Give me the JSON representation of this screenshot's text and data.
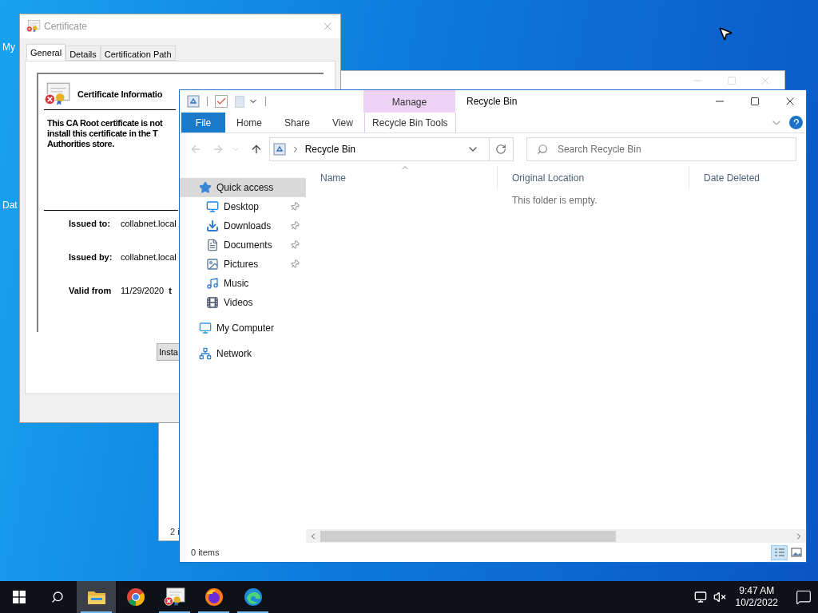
{
  "desktop_icons": [
    {
      "label": "My"
    },
    {
      "label": "Dat"
    }
  ],
  "certificate_window": {
    "title": "Certificate",
    "tabs": [
      {
        "label": "General",
        "selected": true
      },
      {
        "label": "Details",
        "selected": false
      },
      {
        "label": "Certification Path",
        "selected": false
      }
    ],
    "heading": "Certificate Informatio",
    "message_lines": [
      "This CA Root certificate is not",
      "install this certificate in the T",
      "Authorities store."
    ],
    "fields": [
      {
        "label": "Issued to:",
        "value": "collabnet.local"
      },
      {
        "label": "Issued by:",
        "value": "collabnet.local"
      },
      {
        "label": "Valid from",
        "value": "11/29/2020",
        "tail": "t"
      }
    ],
    "button": "Insta"
  },
  "background_window": {
    "status": "2 i"
  },
  "explorer": {
    "title": "Recycle Bin",
    "context_tab": "Manage",
    "ribbon_tabs": [
      {
        "label": "File",
        "kind": "file"
      },
      {
        "label": "Home",
        "kind": "plain"
      },
      {
        "label": "Share",
        "kind": "plain"
      },
      {
        "label": "View",
        "kind": "plain"
      },
      {
        "label": "Recycle Bin Tools",
        "kind": "contextual"
      }
    ],
    "address": "Recycle Bin",
    "search": {
      "placeholder": "Search Recycle Bin"
    },
    "nav": [
      {
        "label": "Quick access",
        "kind": "quick-access",
        "selected": true,
        "pinned": false,
        "children": [
          {
            "label": "Desktop",
            "kind": "desktop",
            "selected": false,
            "pinned": true
          },
          {
            "label": "Downloads",
            "kind": "downloads",
            "selected": false,
            "pinned": true
          },
          {
            "label": "Documents",
            "kind": "documents",
            "selected": false,
            "pinned": true
          },
          {
            "label": "Pictures",
            "kind": "pictures",
            "selected": false,
            "pinned": true
          },
          {
            "label": "Music",
            "kind": "music",
            "selected": false,
            "pinned": false
          },
          {
            "label": "Videos",
            "kind": "videos",
            "selected": false,
            "pinned": false
          }
        ]
      },
      {
        "label": "My Computer",
        "kind": "computer",
        "selected": false,
        "pinned": false
      },
      {
        "label": "Network",
        "kind": "network",
        "selected": false,
        "pinned": false
      }
    ],
    "columns": [
      {
        "label": "Name",
        "sorted": true
      },
      {
        "label": "Original Location",
        "sorted": false
      },
      {
        "label": "Date Deleted",
        "sorted": false
      }
    ],
    "empty_message": "This folder is empty.",
    "status": "0 items",
    "views": [
      {
        "kind": "details",
        "selected": true
      },
      {
        "kind": "large-icons",
        "selected": false
      }
    ]
  },
  "taskbar": {
    "apps": [
      {
        "kind": "explorer",
        "selected": true,
        "running": true
      },
      {
        "kind": "chrome",
        "selected": false,
        "running": false
      },
      {
        "kind": "certificate",
        "selected": false,
        "running": true
      },
      {
        "kind": "firefox",
        "selected": false,
        "running": true
      },
      {
        "kind": "edge",
        "selected": false,
        "running": true
      }
    ],
    "time": "9:47 AM",
    "date": "10/2/2022"
  }
}
